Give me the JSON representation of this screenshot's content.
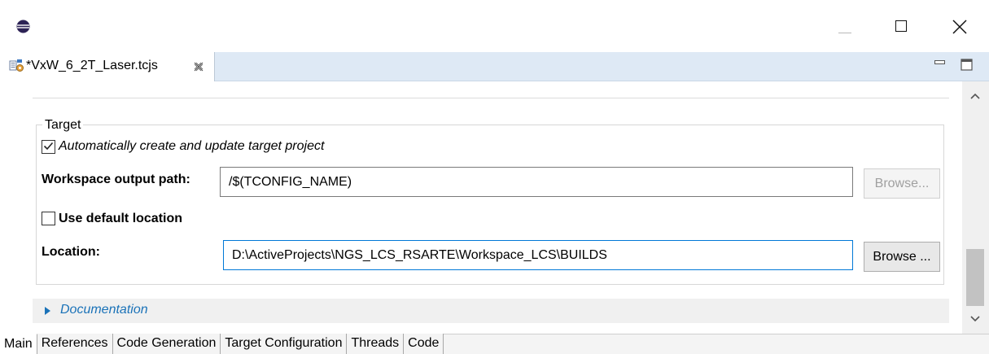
{
  "window": {
    "icon": "eclipse-icon",
    "controls": [
      "minimize-icon",
      "maximize-icon",
      "close-icon"
    ]
  },
  "editor_tab": {
    "label": "*VxW_6_2T_Laser.tcjs",
    "icon": "tcjs-file-icon",
    "close_icon": "close-tab-icon"
  },
  "view_controls": [
    "view-minimize-icon",
    "view-maximize-icon"
  ],
  "target": {
    "legend": "Target",
    "auto_create_label": "Automatically create and update target project",
    "auto_create_checked": true,
    "workspace_output_path_label": "Workspace output path:",
    "workspace_output_path_value": "/$(TCONFIG_NAME)",
    "browse_workspace_label": "Browse...",
    "use_default_location_label": "Use default location",
    "use_default_location_checked": false,
    "location_label": "Location:",
    "location_value": "D:\\ActiveProjects\\NGS_LCS_RSARTE\\Workspace_LCS\\BUILDS",
    "browse_location_label": "Browse ..."
  },
  "documentation": {
    "label": "Documentation",
    "expanded": false
  },
  "bottom_tabs": [
    {
      "label": "Main",
      "active": true
    },
    {
      "label": "References",
      "active": false
    },
    {
      "label": "Code Generation",
      "active": false
    },
    {
      "label": "Target Configuration",
      "active": false
    },
    {
      "label": "Threads",
      "active": false
    },
    {
      "label": "Code",
      "active": false
    }
  ],
  "colors": {
    "tab_bar": "#dee9f5",
    "accent_focus": "#0078d7",
    "link_blue": "#1a72b8"
  }
}
